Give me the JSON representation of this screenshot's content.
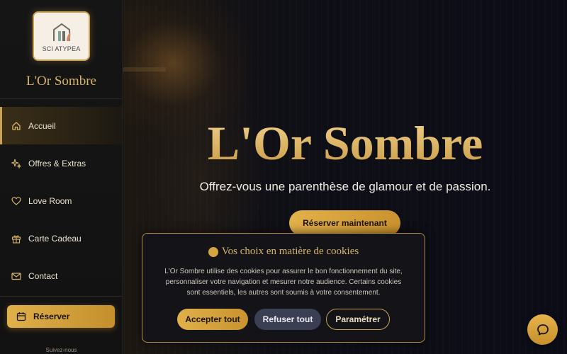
{
  "brand": {
    "logo_text": "SCI ATYPEA",
    "name": "L'Or Sombre"
  },
  "sidebar": {
    "items": [
      {
        "label": "Accueil",
        "icon": "home-icon",
        "active": true
      },
      {
        "label": "Offres & Extras",
        "icon": "sparkles-icon",
        "active": false
      },
      {
        "label": "Love Room",
        "icon": "heart-icon",
        "active": false
      },
      {
        "label": "Carte Cadeau",
        "icon": "gift-icon",
        "active": false
      },
      {
        "label": "Contact",
        "icon": "mail-icon",
        "active": false
      }
    ],
    "reserve_label": "Réserver",
    "reserve_icon": "calendar-icon",
    "follow_label": "Suivez-nous"
  },
  "hero": {
    "title": "L'Or Sombre",
    "subtitle": "Offrez-vous une parenthèse de glamour et de passion.",
    "cta_label": "Réserver maintenant"
  },
  "cookie_banner": {
    "title": "Vos choix en matière de cookies",
    "text": "L'Or Sombre utilise des cookies pour assurer le bon fonctionnement du site, personnaliser votre navigation et mesurer notre audience. Certains cookies sont essentiels, les autres sont soumis à votre consentement.",
    "accept_label": "Accepter tout",
    "refuse_label": "Refuser tout",
    "settings_label": "Paramétrer"
  },
  "chat": {
    "icon": "chat-bubble-icon"
  },
  "colors": {
    "gold": "#d8b46a",
    "button_gold": "#e0b04a",
    "background": "#0b0b12",
    "refuse_button": "#3a3f54"
  }
}
